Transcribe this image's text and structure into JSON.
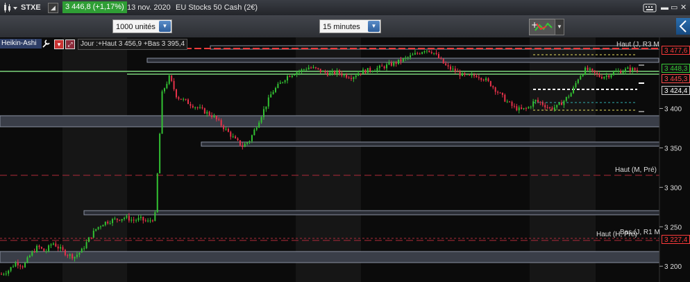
{
  "header": {
    "symbol": "STXE",
    "price_change": "3 446,8 (+1,17%)",
    "date": "13 nov. 2020",
    "instrument_name": "EU Stocks 50 Cash (2€)",
    "icons": [
      "candlestick-icon",
      "dropdown-arrow-icon",
      "keyboard-icon",
      "minimize-icon",
      "maximize-icon",
      "close-icon"
    ]
  },
  "toolbar": {
    "quantity_value": "1000 unités",
    "timeframe_value": "15 minutes",
    "icons": [
      "indicator-tool-icon",
      "side-panel-icon"
    ]
  },
  "chart": {
    "type_label": "Heikin-Ashi",
    "info_text": "Jour :+Haut 3 456,9 +Bas 3 395,4",
    "y_ticks": [
      "3 200",
      "3 250",
      "3 300",
      "3 350",
      "3 400"
    ],
    "price_boxes": [
      {
        "label": "3 477,6",
        "color": "#ff3b3b"
      },
      {
        "label": "3 448,3",
        "color": "#37c837"
      },
      {
        "label": "3 445,3",
        "color": "#ff4d4d"
      },
      {
        "label": "3 424,4",
        "color": "#ffffff"
      },
      {
        "label": "3 227,4",
        "color": "#ff3b3b"
      }
    ],
    "level_labels": [
      {
        "text": "Haut (J, R3 M",
        "color": "#e03a3a"
      },
      {
        "text": "Haut (M, Pré)",
        "color": "#e03a3a"
      },
      {
        "text": "Haut (H, Pré)",
        "color": "#e03a3a"
      },
      {
        "text": "Bas (J, R1 M",
        "color": "#e03a3a"
      }
    ],
    "colors": {
      "up": "#33c233",
      "down": "#e8324a",
      "zone": "#5a6070"
    }
  },
  "chart_data": {
    "type": "line",
    "ylim": [
      3180,
      3490
    ],
    "close_series": [
      3190,
      3195,
      3205,
      3200,
      3215,
      3225,
      3218,
      3230,
      3222,
      3215,
      3212,
      3220,
      3235,
      3248,
      3255,
      3258,
      3260,
      3262,
      3258,
      3260,
      3256,
      3262,
      3420,
      3440,
      3415,
      3410,
      3405,
      3400,
      3395,
      3390,
      3380,
      3370,
      3360,
      3352,
      3360,
      3380,
      3400,
      3420,
      3430,
      3440,
      3445,
      3448,
      3452,
      3450,
      3446,
      3444,
      3446,
      3442,
      3440,
      3446,
      3448,
      3450,
      3452,
      3455,
      3458,
      3462,
      3466,
      3470,
      3475,
      3472,
      3462,
      3452,
      3448,
      3442,
      3440,
      3442,
      3438,
      3430,
      3420,
      3410,
      3402,
      3398,
      3400,
      3410,
      3406,
      3400,
      3402,
      3410,
      3420,
      3440,
      3450,
      3445,
      3440,
      3442,
      3446,
      3448,
      3450,
      3448
    ]
  }
}
